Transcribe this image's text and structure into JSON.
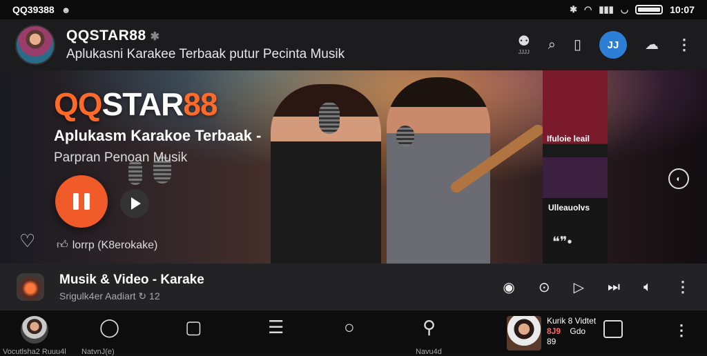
{
  "status": {
    "left_text": "QQ39388",
    "left_icon": "cat-icon",
    "time": "10:07",
    "battery_percent": 100
  },
  "header": {
    "title": "QQSTAR88",
    "subtitle": "Aplukasni Karakee Terbaak putur Pecinta Musik",
    "avatar_icon": "singer-avatar",
    "blue_button_label": "JJ",
    "mini_label": "JJJJ"
  },
  "banner": {
    "brand_orange": "QQ",
    "brand_white": "STAR",
    "brand_orange2": "88",
    "tagline": "Aplukasm Karakoe Terbaak -",
    "subtagline": "Parpran Penoan Musik",
    "like_label": "lorrp (K8erokake)",
    "side_label_top": "Ifuloie leail",
    "side_label_bottom": "Ulleauolvs"
  },
  "now_playing": {
    "title": "Musik & Video - Karake",
    "subtitle": "Srigulk4er Aadiart",
    "count": "12"
  },
  "bottom_nav": {
    "item1_label": "Vocutlsha2 Ruuu4l",
    "item2_label": "NatvnJ(e)",
    "item6_label": "Navu4d",
    "mini_title": "Kurik 8 Vidtet",
    "mini_line2": "8J9",
    "mini_line2b": "Gdo",
    "mini_line3": "89"
  },
  "colors": {
    "accent": "#f15a29",
    "brand_orange": "#ff6a2b",
    "blue": "#2d7fd6"
  }
}
